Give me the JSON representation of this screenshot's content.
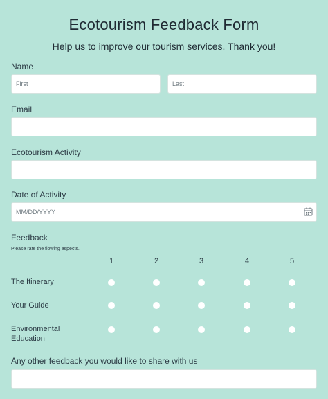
{
  "form": {
    "title": "Ecotourism Feedback Form",
    "subtitle": "Help us to improve our tourism services. Thank you!"
  },
  "name": {
    "label": "Name",
    "first_placeholder": "First",
    "last_placeholder": "Last"
  },
  "email": {
    "label": "Email"
  },
  "activity": {
    "label": "Ecotourism Activity"
  },
  "date": {
    "label": "Date of Activity",
    "placeholder": "MM/DD/YYYY"
  },
  "feedback": {
    "label": "Feedback",
    "hint": "Please rate the flowing aspects.",
    "scale": [
      "1",
      "2",
      "3",
      "4",
      "5"
    ],
    "rows": [
      {
        "label": "The Itinerary"
      },
      {
        "label": "Your Guide"
      },
      {
        "label": "Environmental Education"
      }
    ]
  },
  "other": {
    "label": "Any other feedback you would like to share with us"
  },
  "colors": {
    "background": "#b7e4d9",
    "field": "#ffffff",
    "text": "#2c3b45"
  }
}
